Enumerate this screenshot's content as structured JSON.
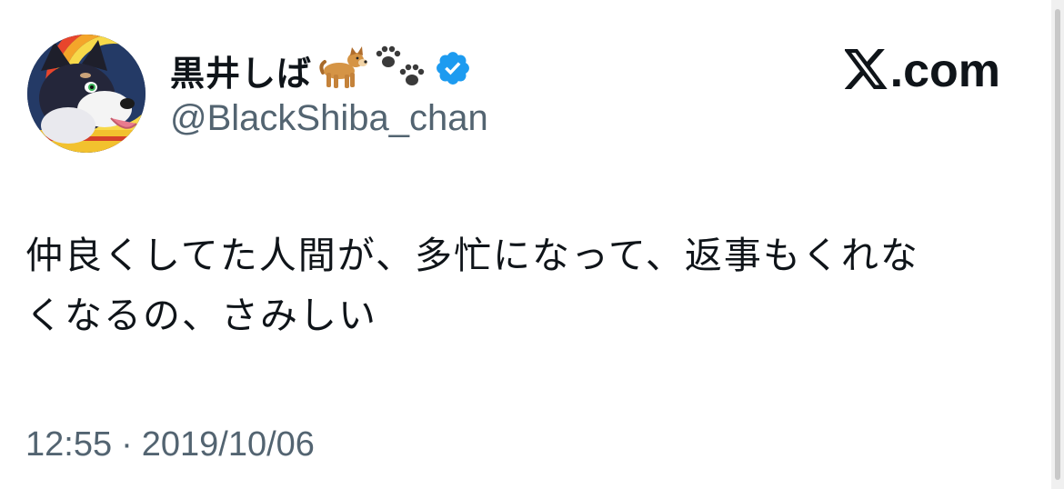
{
  "author": {
    "display_name": "黒井しば",
    "handle": "@BlackShiba_chan",
    "verified": true,
    "name_emojis": [
      "dog-emoji",
      "paw-prints-emoji"
    ],
    "verified_color": "#1d9bf0"
  },
  "brand": {
    "logo_icon": "x-logo-icon",
    "domain_suffix": ".com"
  },
  "tweet": {
    "text": "仲良くしてた人間が、多忙になって、返事もくれな\nくなるの、さみしい",
    "time": "12:55",
    "separator": "·",
    "date": "2019/10/06"
  },
  "colors": {
    "text_primary": "#0f1419",
    "text_secondary": "#536471",
    "background": "#ffffff"
  }
}
